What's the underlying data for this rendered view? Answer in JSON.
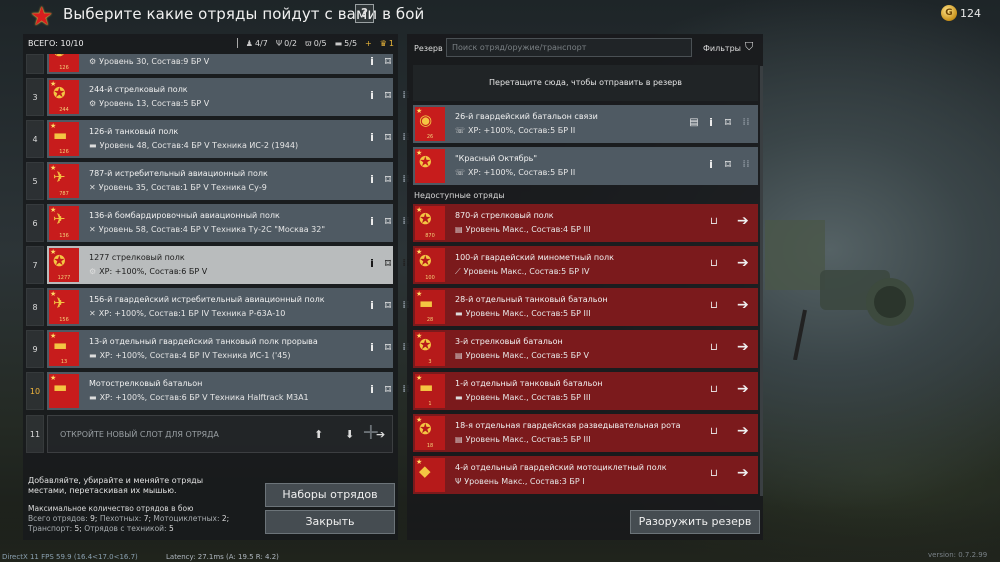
{
  "header": {
    "title": "Выберите какие отряды пойдут с вами в бой",
    "help_label": "?",
    "balance": "124"
  },
  "left": {
    "total": "ВСЕГО: 10/10",
    "stats": [
      {
        "icon": "infantry-icon",
        "value": "4/7"
      },
      {
        "icon": "radio-icon",
        "value": "0/2"
      },
      {
        "icon": "motorcycle-icon",
        "value": "0/5"
      },
      {
        "icon": "vehicle-icon",
        "value": "5/5"
      },
      {
        "icon": "plus-icon",
        "value": "+"
      },
      {
        "icon": "rank-icon",
        "value": "1"
      }
    ],
    "rows": [
      {
        "num": "",
        "emblem": "126",
        "name": "",
        "info": "Уровень 30, Состав:9 БР V",
        "partial": true
      },
      {
        "num": "3",
        "emblem": "244",
        "name": "244-й стрелковый полк",
        "info": "Уровень 13, Состав:5  БР V"
      },
      {
        "num": "4",
        "emblem": "126",
        "name": "126-й танковый полк",
        "info": "Уровень 48, Состав:4  БР V  Техника ИС-2 (1944)"
      },
      {
        "num": "5",
        "emblem": "787",
        "name": "787-й истребительный авиационный полк",
        "info": "Уровень 35, Состав:1  БР V  Техника Су-9"
      },
      {
        "num": "6",
        "emblem": "136",
        "name": "136-й бомбардировочный авиационный полк",
        "info": "Уровень 58, Состав:4  БР V  Техника Ту-2С \"Москва 32\""
      },
      {
        "num": "7",
        "emblem": "1277",
        "name": "1277 стрелковый полк",
        "info": "XP: +100%, Состав:6  БР V",
        "selected": true
      },
      {
        "num": "8",
        "emblem": "156",
        "name": "156-й гвардейский истребительный авиационный полк",
        "info": "XP: +100%, Состав:1  БР IV  Техника Р-63А-10"
      },
      {
        "num": "9",
        "emblem": "13",
        "name": "13-й отдельный гвардейский танковый полк прорыва",
        "info": "XP: +100%, Состав:4  БР IV  Техника ИС-1 ('45)"
      },
      {
        "num": "10",
        "emblem": "",
        "name": "Мотострелковый батальон",
        "info": "XP: +100%, Состав:6  БР V  Техника Halftrack M3A1"
      }
    ],
    "empty_slot": {
      "num": "11",
      "label": "ОТКРОЙТЕ НОВЫЙ СЛОТ ДЛЯ ОТРЯДА"
    },
    "hint": "Добавляйте, убирайте и меняйте отряды местами, перетаскивая их мышью.",
    "max_title": "Максимальное количество отрядов в бою",
    "max_line1_k1": "Всего отрядов:",
    "max_line1_v1": "9;",
    "max_line1_k2": "Пехотных:",
    "max_line1_v2": "7;",
    "max_line1_k3": "Мотоциклетных:",
    "max_line1_v3": "2;",
    "max_line2_k1": "Транспорт:",
    "max_line2_v1": "5;",
    "max_line2_k2": "Отрядов с техникой:",
    "max_line2_v2": "5",
    "sets_button": "Наборы отрядов",
    "close_button": "Закрыть"
  },
  "right": {
    "reserve_label": "Резерв",
    "search_placeholder": "Поиск отряд/оружие/транспорт",
    "filters_label": "Фильтры",
    "drop_zone": "Перетащите сюда, чтобы отправить в резерв",
    "reserve": [
      {
        "emblem": "26",
        "name": "26-й гвардейский батальон связи",
        "info": "XP: +100%, Состав:5  БР II"
      },
      {
        "emblem": "",
        "name": "\"Красный Октябрь\"",
        "info": "XP: +100%, Состав:5  БР II"
      }
    ],
    "unavailable_label": "Недоступные отряды",
    "unavailable": [
      {
        "emblem": "870",
        "name": "870-й стрелковый полк",
        "info": "Уровень Макс., Состав:4  БР III"
      },
      {
        "emblem": "100",
        "name": "100-й гвардейский минометный полк",
        "info": "Уровень Макс., Состав:5  БР IV"
      },
      {
        "emblem": "28",
        "name": "28-й отдельный танковый батальон",
        "info": "Уровень Макс., Состав:5  БР III"
      },
      {
        "emblem": "3",
        "name": "3-й стрелковый батальон",
        "info": "Уровень Макс., Состав:5  БР V"
      },
      {
        "emblem": "1",
        "name": "1-й отдельный танковый батальон",
        "info": "Уровень Макс., Состав:5  БР III"
      },
      {
        "emblem": "18",
        "name": "18-я отдельная гвардейская разведывательная рота",
        "info": "Уровень Макс., Состав:5  БР III"
      },
      {
        "emblem": "",
        "name": "4-й отдельный гвардейский мотоциклетный полк",
        "info": "Уровень Макс., Состав:3  БР I"
      }
    ],
    "disarm_button": "Разоружить резерв"
  },
  "footer": {
    "fps": "DirectX 11 FPS 59.9 (16.4<17.0<16.7)",
    "latency": "Latency: 27.1ms (A: 19.5 R: 4.2)",
    "version": "version: 0.7.2.99"
  },
  "colors": {
    "accent_red": "#c71c1c",
    "gold": "#e8b53a",
    "card": "#4f5a63",
    "card_red": "#7b1a1c"
  }
}
